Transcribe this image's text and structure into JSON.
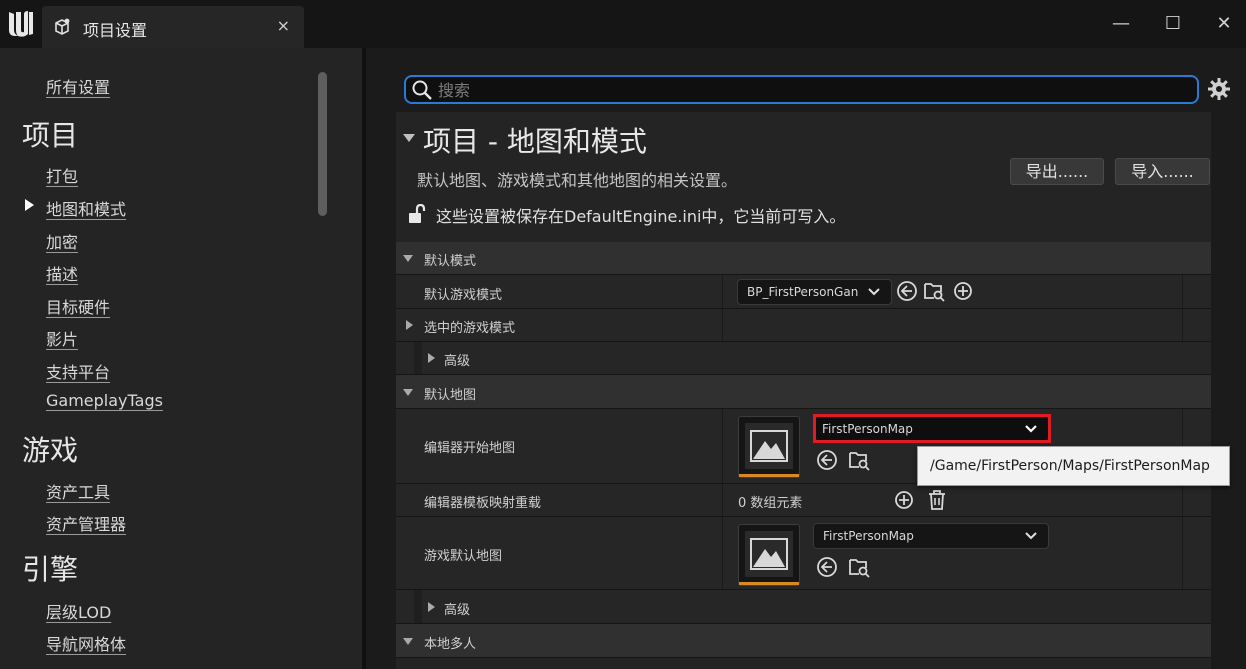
{
  "window": {
    "tab_label": "项目设置",
    "tab_close": "×",
    "min_glyph": "—",
    "max_glyph": "☐",
    "close_glyph": "✕"
  },
  "sidebar": {
    "all_settings": "所有设置",
    "sections": [
      {
        "heading": "项目",
        "items": [
          "打包",
          "地图和模式",
          "加密",
          "描述",
          "目标硬件",
          "影片",
          "支持平台",
          "GameplayTags"
        ]
      },
      {
        "heading": "游戏",
        "items": [
          "资产工具",
          "资产管理器"
        ]
      },
      {
        "heading": "引擎",
        "items": [
          "层级LOD",
          "导航网格体"
        ]
      }
    ],
    "selected_item": "地图和模式"
  },
  "search": {
    "placeholder": "搜索",
    "value": ""
  },
  "main": {
    "title": "项目 - 地图和模式",
    "description": "默认地图、游戏模式和其他地图的相关设置。",
    "export_label": "导出......",
    "import_label": "导入......",
    "lock_text": "这些设置被保存在DefaultEngine.ini中，它当前可写入。"
  },
  "rows": {
    "default_modes_header": "默认模式",
    "default_game_mode_label": "默认游戏模式",
    "default_game_mode_value": "BP_FirstPersonGan",
    "selected_game_mode_label": "选中的游戏模式",
    "advanced_label_1": "高级",
    "default_maps_header": "默认地图",
    "editor_startup_map_label": "编辑器开始地图",
    "editor_startup_map_value": "FirstPersonMap",
    "editor_template_map_label": "编辑器模板映射重载",
    "editor_template_map_value": "0 数组元素",
    "game_default_map_label": "游戏默认地图",
    "game_default_map_value": "FirstPersonMap",
    "advanced_label_2": "高级",
    "local_multiplayer_header": "本地多人"
  },
  "tooltip": {
    "text": "/Game/FirstPerson/Maps/FirstPersonMap"
  },
  "colors": {
    "accent": "#2b7bd6",
    "highlight": "#e01b24",
    "asset_bar": "#d98a1f"
  }
}
